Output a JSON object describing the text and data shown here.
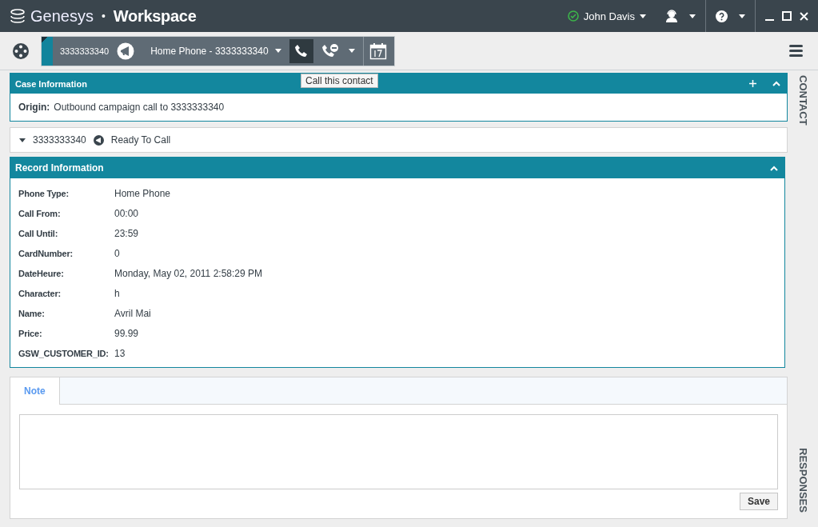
{
  "app": {
    "brand": "Genesys",
    "separator": "•",
    "product": "Workspace"
  },
  "user": {
    "name": "John Davis",
    "available": true
  },
  "interaction": {
    "number": "3333333340",
    "phone_selector": "Home Phone - 3333333340",
    "tooltip": "Call this contact"
  },
  "case_information": {
    "title": "Case Information",
    "expanded": true,
    "origin_label": "Origin:",
    "origin_value": "Outbound campaign call to 3333333340"
  },
  "contact_line": {
    "number": "3333333340",
    "status": "Ready To Call",
    "expanded": false
  },
  "record_information": {
    "title": "Record Information",
    "expanded": true,
    "fields": [
      {
        "label": "Phone Type:",
        "value": "Home Phone"
      },
      {
        "label": "Call From:",
        "value": "00:00"
      },
      {
        "label": "Call Until:",
        "value": "23:59"
      },
      {
        "label": "CardNumber:",
        "value": "0"
      },
      {
        "label": "DateHeure:",
        "value": "Monday, May 02, 2011 2:58:29 PM"
      },
      {
        "label": "Character:",
        "value": "h"
      },
      {
        "label": "Name:",
        "value": "Avril Mai"
      },
      {
        "label": "Price:",
        "value": "99.99"
      },
      {
        "label": "GSW_CUSTOMER_ID:",
        "value": "13"
      }
    ]
  },
  "note": {
    "tabs": [
      {
        "label": "Note",
        "selected": true
      }
    ],
    "save_button": "Save"
  },
  "side_tabs": [
    {
      "label": "CONTACT"
    },
    {
      "label": "RESPONSES"
    }
  ]
}
